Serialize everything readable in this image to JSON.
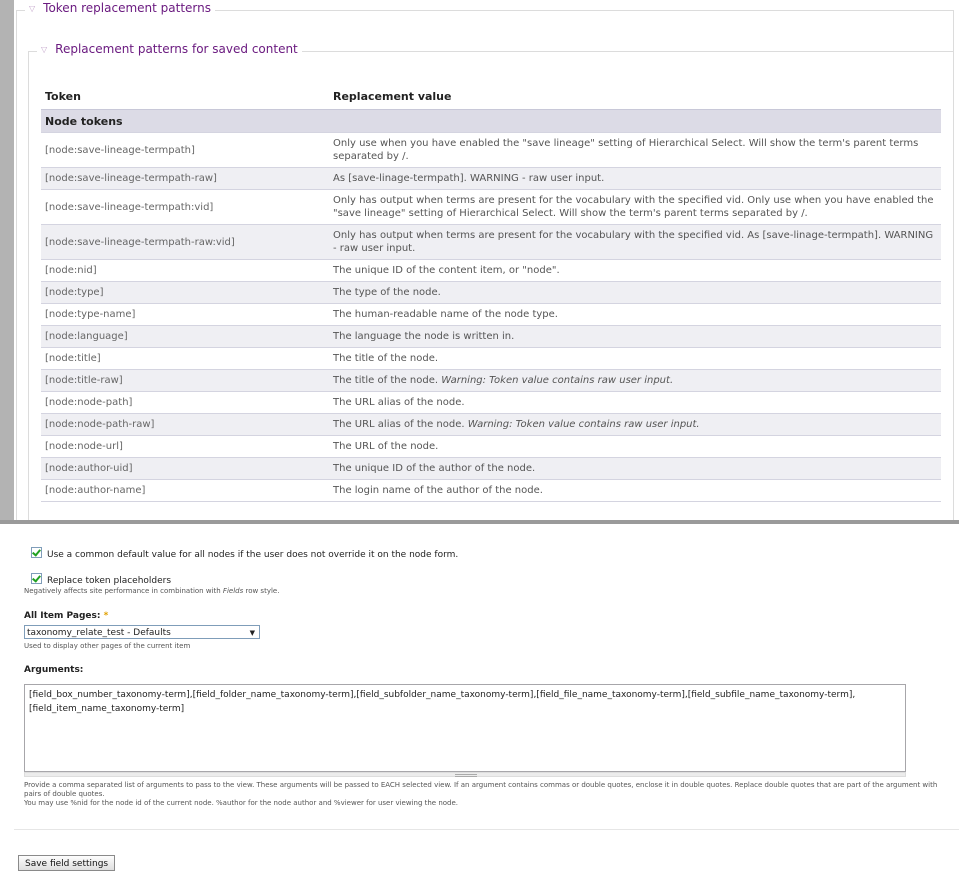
{
  "fieldsets": {
    "outer_legend": "Token replacement patterns",
    "inner_legend": "Replacement patterns for saved content"
  },
  "table": {
    "headers": [
      "Token",
      "Replacement value"
    ],
    "group": "Node tokens",
    "rows": [
      {
        "token": "[node:save-lineage-termpath]",
        "value": "Only use when you have enabled the \"save lineage\" setting of Hierarchical Select. Will show the term's parent terms separated by /."
      },
      {
        "token": "[node:save-lineage-termpath-raw]",
        "value": "As [save-linage-termpath]. WARNING - raw user input."
      },
      {
        "token": "[node:save-lineage-termpath:vid]",
        "value": "Only has output when terms are present for the vocabulary with the specified vid. Only use when you have enabled the \"save lineage\" setting of Hierarchical Select. Will show the term's parent terms separated by /."
      },
      {
        "token": "[node:save-lineage-termpath-raw:vid]",
        "value": "Only has output when terms are present for the vocabulary with the specified vid. As [save-linage-termpath]. WARNING - raw user input."
      },
      {
        "token": "[node:nid]",
        "value": "The unique ID of the content item, or \"node\"."
      },
      {
        "token": "[node:type]",
        "value": "The type of the node."
      },
      {
        "token": "[node:type-name]",
        "value": "The human-readable name of the node type."
      },
      {
        "token": "[node:language]",
        "value": "The language the node is written in."
      },
      {
        "token": "[node:title]",
        "value": "The title of the node."
      },
      {
        "token": "[node:title-raw]",
        "value": "The title of the node.",
        "warning": "Warning: Token value contains raw user input."
      },
      {
        "token": "[node:node-path]",
        "value": "The URL alias of the node."
      },
      {
        "token": "[node:node-path-raw]",
        "value": "The URL alias of the node.",
        "warning": "Warning: Token value contains raw user input."
      },
      {
        "token": "[node:node-url]",
        "value": "The URL of the node."
      },
      {
        "token": "[node:author-uid]",
        "value": "The unique ID of the author of the node."
      },
      {
        "token": "[node:author-name]",
        "value": "The login name of the author of the node."
      }
    ]
  },
  "form": {
    "common_default_label": "Use a common default value for all nodes if the user does not override it on the node form.",
    "replace_tokens_label": "Replace token placeholders",
    "replace_tokens_desc_before": "Negatively affects site performance in combination with ",
    "replace_tokens_desc_em": "Fields",
    "replace_tokens_desc_after": " row style.",
    "item_pages_label": "All Item Pages:",
    "required_mark": "*",
    "item_pages_value": "taxonomy_relate_test - Defaults",
    "item_pages_desc": "Used to display other pages of the current item",
    "arguments_label": "Arguments:",
    "arguments_value": "[field_box_number_taxonomy-term],[field_folder_name_taxonomy-term],[field_subfolder_name_taxonomy-term],[field_file_name_taxonomy-term],[field_subfile_name_taxonomy-term],[field_item_name_taxonomy-term]",
    "arguments_desc_1": "Provide a comma separated list of arguments to pass to the view. These arguments will be passed to EACH selected view. If an argument contains commas or double quotes, enclose it in double quotes. Replace double quotes that are part of the argument with pairs of double quotes.",
    "arguments_desc_2": "You may use %nid for the node id of the current node. %author for the node author and %viewer for user viewing the node.",
    "save_button": "Save field settings"
  }
}
